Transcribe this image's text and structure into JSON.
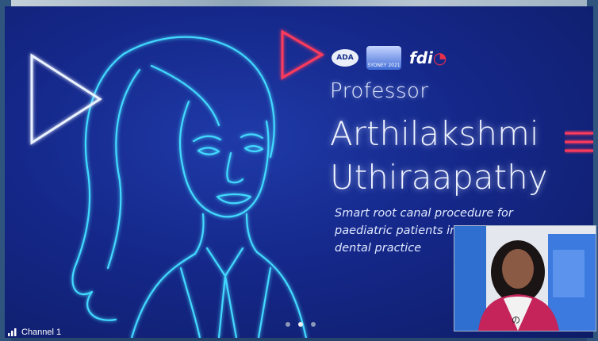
{
  "slide": {
    "title_prefix": "Professor",
    "name_line1": "Arthilakshmi",
    "name_line2": "Uthiraapathy",
    "subtitle_lines": [
      "Smart root canal procedure for",
      "paediatric patients in",
      "dental practice"
    ],
    "logos": {
      "ada": "ADA",
      "sydney": "SYDNEY 2021",
      "fdi": "fdi"
    }
  },
  "player": {
    "channel_label": "Channel 1",
    "pager": {
      "count": 3,
      "active_index": 1
    }
  },
  "colors": {
    "neon_cyan": "#43d9ff",
    "neon_red": "#ff3b5c",
    "screen_bg": "#15288a"
  },
  "icons": [
    "play-neon-icon-white",
    "play-neon-icon-red",
    "menu-lines-icon",
    "signal-bars-icon"
  ]
}
